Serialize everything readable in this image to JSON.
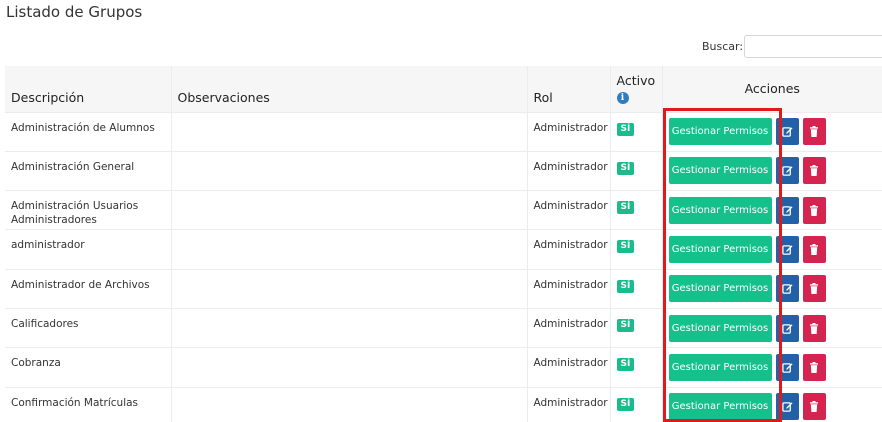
{
  "page": {
    "title": "Listado de Grupos"
  },
  "search": {
    "label": "Buscar:",
    "value": "",
    "placeholder": ""
  },
  "table": {
    "headers": {
      "descripcion": "Descripción",
      "observaciones": "Observaciones",
      "rol": "Rol",
      "activo": "Activo",
      "acciones": "Acciones"
    },
    "rows": [
      {
        "descripcion": "Administración de Alumnos",
        "observaciones": "",
        "rol": "Administrador",
        "activo": "SÍ"
      },
      {
        "descripcion": "Administración General",
        "observaciones": "",
        "rol": "Administrador",
        "activo": "SÍ"
      },
      {
        "descripcion": "Administración Usuarios Administradores",
        "observaciones": "",
        "rol": "Administrador",
        "activo": "SÍ"
      },
      {
        "descripcion": "administrador",
        "observaciones": "",
        "rol": "Administrador",
        "activo": "SÍ"
      },
      {
        "descripcion": "Administrador de Archivos",
        "observaciones": "",
        "rol": "Administrador",
        "activo": "SÍ"
      },
      {
        "descripcion": "Calificadores",
        "observaciones": "",
        "rol": "Administrador",
        "activo": "SÍ"
      },
      {
        "descripcion": "Cobranza",
        "observaciones": "",
        "rol": "Administrador",
        "activo": "SÍ"
      },
      {
        "descripcion": "Confirmación Matrículas",
        "observaciones": "",
        "rol": "Administrador",
        "activo": "SÍ"
      }
    ]
  },
  "actions": {
    "manage_label": "Gestionar Permisos"
  },
  "colors": {
    "manage": "#16c08a",
    "edit": "#2260a8",
    "delete": "#d52450",
    "badge": "#1abc8c",
    "highlight": "#e01a1a"
  },
  "icons": {
    "info": "info-icon",
    "edit": "edit-icon",
    "delete": "trash-icon"
  }
}
